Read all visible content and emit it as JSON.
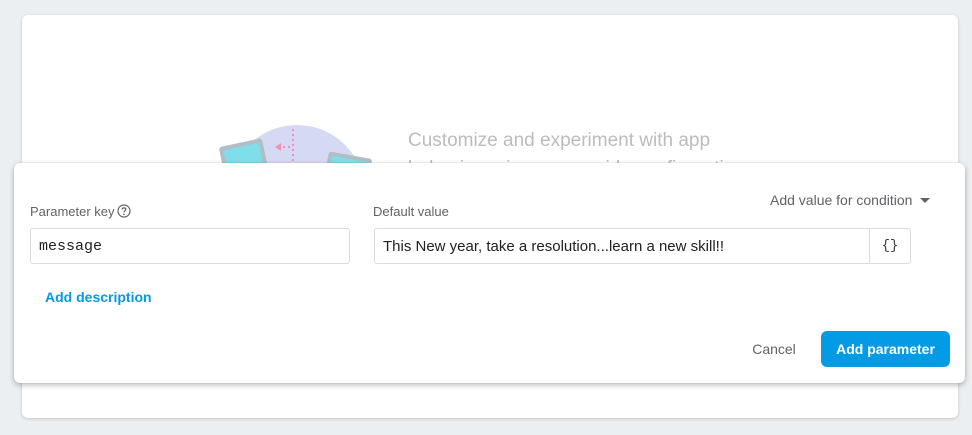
{
  "promo": {
    "line1": "Customize and experiment with app",
    "line2": "behavior using server-side configuration"
  },
  "form": {
    "param_key_label": "Parameter key",
    "param_key_value": "message",
    "default_value_label": "Default value",
    "default_value": "This New year, take a resolution...learn a new skill!!",
    "json_editor_glyph": "{}",
    "add_condition_label": "Add value for condition",
    "add_description_label": "Add description",
    "cancel_label": "Cancel",
    "add_parameter_label": "Add parameter"
  },
  "icons": {
    "help": "help-circle-icon",
    "dropdown": "caret-down-icon",
    "json": "json-braces-icon"
  },
  "colors": {
    "accent": "#039be5",
    "page_bg": "#eceff1",
    "promo_text": "#b9bdc1"
  }
}
